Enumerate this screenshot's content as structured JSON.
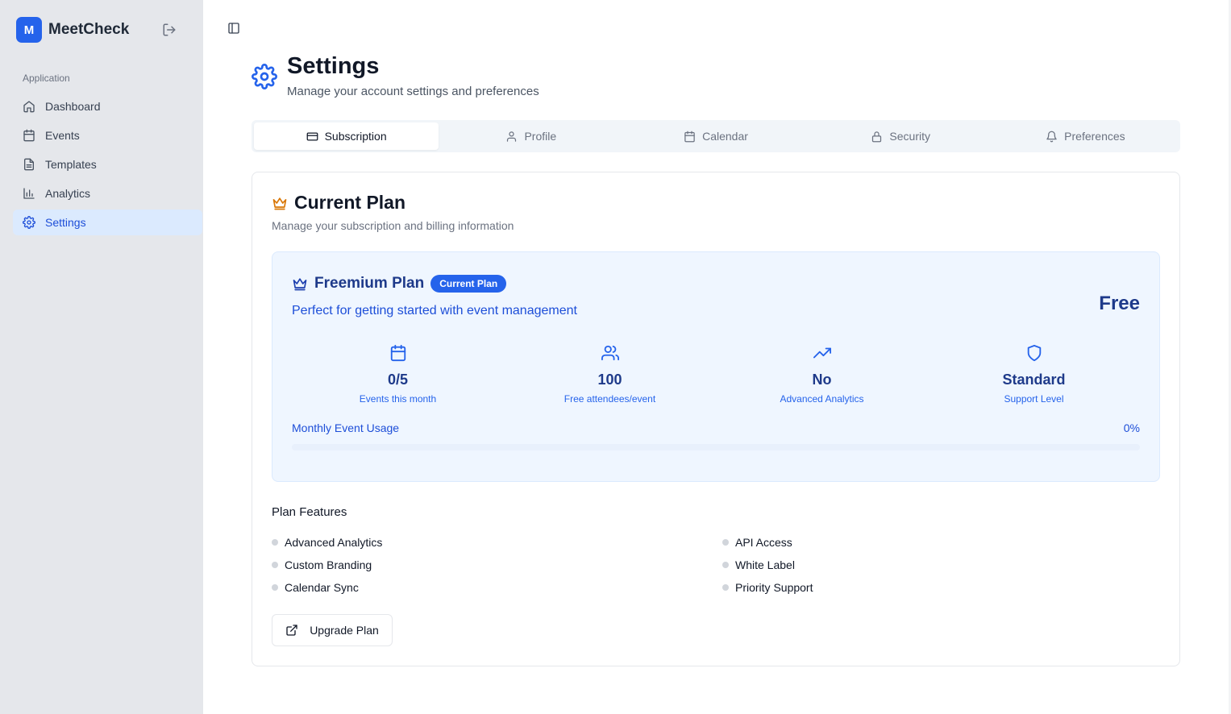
{
  "brand": {
    "logo_letter": "M",
    "name": "MeetCheck"
  },
  "sidebar": {
    "section_label": "Application",
    "items": [
      {
        "label": "Dashboard",
        "icon": "home-icon"
      },
      {
        "label": "Events",
        "icon": "calendar-icon"
      },
      {
        "label": "Templates",
        "icon": "file-text-icon"
      },
      {
        "label": "Analytics",
        "icon": "bar-chart-icon"
      },
      {
        "label": "Settings",
        "icon": "gear-icon",
        "active": true
      }
    ]
  },
  "page": {
    "title": "Settings",
    "subtitle": "Manage your account settings and preferences"
  },
  "tabs": [
    {
      "label": "Subscription",
      "icon": "credit-card-icon",
      "active": true
    },
    {
      "label": "Profile",
      "icon": "user-icon"
    },
    {
      "label": "Calendar",
      "icon": "calendar-icon"
    },
    {
      "label": "Security",
      "icon": "lock-icon"
    },
    {
      "label": "Preferences",
      "icon": "bell-icon"
    }
  ],
  "current_plan": {
    "title": "Current Plan",
    "subtitle": "Manage your subscription and billing information",
    "plan": {
      "name": "Freemium Plan",
      "badge": "Current Plan",
      "description": "Perfect for getting started with event management",
      "price": "Free",
      "stats": [
        {
          "value": "0/5",
          "label": "Events this month",
          "icon": "calendar-icon"
        },
        {
          "value": "100",
          "label": "Free attendees/event",
          "icon": "users-icon"
        },
        {
          "value": "No",
          "label": "Advanced Analytics",
          "icon": "trending-up-icon"
        },
        {
          "value": "Standard",
          "label": "Support Level",
          "icon": "shield-icon"
        }
      ],
      "usage": {
        "label": "Monthly Event Usage",
        "percent_text": "0%",
        "fraction": 0
      }
    },
    "features_title": "Plan Features",
    "features": [
      "Advanced Analytics",
      "API Access",
      "Custom Branding",
      "White Label",
      "Calendar Sync",
      "Priority Support"
    ],
    "upgrade_label": "Upgrade Plan"
  },
  "colors": {
    "accent": "#2563eb",
    "sidebar_bg": "#e5e7eb",
    "crown": "#d97706",
    "plan_bg": "#eff6ff",
    "plan_text": "#1e3a8a"
  }
}
